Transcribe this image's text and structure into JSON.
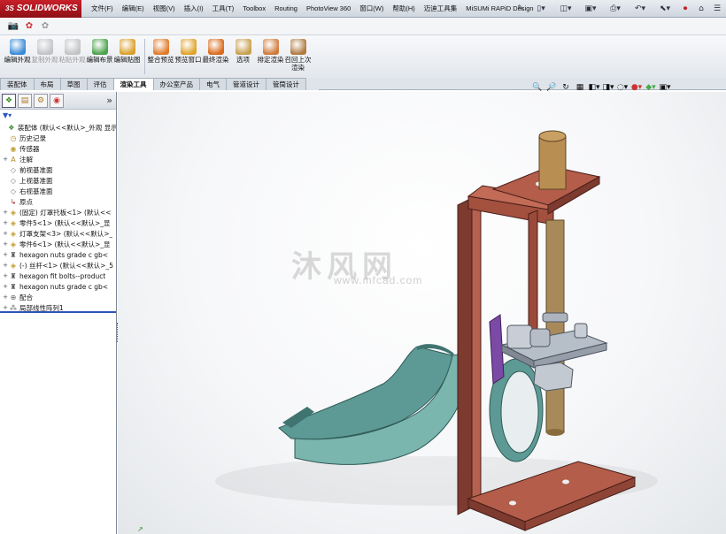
{
  "app": {
    "logo": "SOLIDWORKS",
    "logo_prefix": "3S"
  },
  "menu": [
    "文件(F)",
    "编辑(E)",
    "视图(V)",
    "插入(I)",
    "工具(T)",
    "Toolbox",
    "Routing",
    "PhotoView 360",
    "窗口(W)",
    "帮助(H)",
    "迈迪工具集",
    "MiSUMi RAPiD Design"
  ],
  "title_tools": [
    "pin-icon",
    "new-doc-icon",
    "open-icon",
    "save-icon",
    "print-icon",
    "undo-icon",
    "select-icon",
    "rebuild-icon",
    "options-icon",
    "help-icon"
  ],
  "quick_tools": [
    "camera-icon",
    "render-settings-icon",
    "render-icon"
  ],
  "command_buttons": [
    {
      "label": "编辑外观",
      "enabled": true,
      "color": "#3a8ad6"
    },
    {
      "label": "复制外观",
      "enabled": false,
      "color": "#8a8a8a"
    },
    {
      "label": "粘贴外观",
      "enabled": false,
      "color": "#8a8a8a"
    },
    {
      "label": "编辑布景",
      "enabled": true,
      "color": "#4aa24a"
    },
    {
      "label": "编辑贴图",
      "enabled": true,
      "color": "#d9a02a"
    },
    {
      "label": "整合预览",
      "enabled": true,
      "color": "#e07a2a"
    },
    {
      "label": "预览窗口",
      "enabled": true,
      "color": "#e0a32a"
    },
    {
      "label": "最终渲染",
      "enabled": true,
      "color": "#d96a1a"
    },
    {
      "label": "选项",
      "enabled": true,
      "color": "#c8a050"
    },
    {
      "label": "排定渲染",
      "enabled": true,
      "color": "#d07a3a"
    },
    {
      "label": "召回上次渲染",
      "enabled": true,
      "color": "#b07a40"
    }
  ],
  "tabs": [
    {
      "label": "装配体",
      "active": false
    },
    {
      "label": "布局",
      "active": false
    },
    {
      "label": "草图",
      "active": false
    },
    {
      "label": "评估",
      "active": false
    },
    {
      "label": "渲染工具",
      "active": true
    },
    {
      "label": "办公室产品",
      "active": false
    },
    {
      "label": "电气",
      "active": false
    },
    {
      "label": "管道设计",
      "active": false
    },
    {
      "label": "管筒设计",
      "active": false
    }
  ],
  "hud_tools": [
    "zoom-fit-icon",
    "zoom-area-icon",
    "previous-view-icon",
    "section-view-icon",
    "view-orientation-icon",
    "display-style-icon",
    "hide-show-icon",
    "edit-appearance-icon",
    "apply-scene-icon",
    "view-settings-icon"
  ],
  "panel_tabs": [
    "feature-manager-icon",
    "property-manager-icon",
    "configuration-manager-icon",
    "display-manager-icon"
  ],
  "tree": [
    {
      "label": "装配体 (默认<<默认>_外观 显示",
      "icon": "assembly-icon",
      "expand": "",
      "indent": 0
    },
    {
      "label": "历史记录",
      "icon": "history-icon",
      "expand": "",
      "indent": 1
    },
    {
      "label": "传感器",
      "icon": "sensor-icon",
      "expand": "",
      "indent": 1
    },
    {
      "label": "注解",
      "icon": "annotation-icon",
      "expand": "+",
      "indent": 1
    },
    {
      "label": "前视基准面",
      "icon": "plane-icon",
      "expand": "",
      "indent": 1
    },
    {
      "label": "上视基准面",
      "icon": "plane-icon",
      "expand": "",
      "indent": 1
    },
    {
      "label": "右视基准面",
      "icon": "plane-icon",
      "expand": "",
      "indent": 1
    },
    {
      "label": "原点",
      "icon": "origin-icon",
      "expand": "",
      "indent": 1
    },
    {
      "label": "(固定) 灯罩托板<1> (默认<<",
      "icon": "part-icon",
      "expand": "+",
      "indent": 1
    },
    {
      "label": "零件5<1> (默认<<默认>_显",
      "icon": "part-icon",
      "expand": "+",
      "indent": 1
    },
    {
      "label": "灯罩支架<3> (默认<<默认>_",
      "icon": "part-icon",
      "expand": "+",
      "indent": 1
    },
    {
      "label": "零件6<1> (默认<<默认>_显",
      "icon": "part-icon",
      "expand": "+",
      "indent": 1
    },
    {
      "label": "hexagon nuts grade c gb<",
      "icon": "toolbox-part-icon",
      "expand": "+",
      "indent": 1
    },
    {
      "label": "(-) 丝杆<1> (默认<<默认>_5",
      "icon": "part-icon",
      "expand": "+",
      "indent": 1
    },
    {
      "label": "hexagon fit bolts--product",
      "icon": "toolbox-part-icon",
      "expand": "+",
      "indent": 1
    },
    {
      "label": "hexagon nuts grade c gb<",
      "icon": "toolbox-part-icon",
      "expand": "+",
      "indent": 1
    },
    {
      "label": "配合",
      "icon": "mates-icon",
      "expand": "+",
      "indent": 1
    },
    {
      "label": "局部线性阵列1",
      "icon": "pattern-icon",
      "expand": "+",
      "indent": 1
    }
  ],
  "watermark": {
    "main": "沐风网",
    "sub": "www.mfcad.com"
  },
  "colors": {
    "bracket": "#a8594a",
    "bracket_dark": "#6f3027",
    "rod": "#b58a4e",
    "rod_dark": "#7a5a2e",
    "shade": "#6ea8a2",
    "shade_dark": "#3f7470",
    "plate": "#9aa4b0",
    "purple": "#7a4aa6",
    "nut": "#c9ced6"
  }
}
